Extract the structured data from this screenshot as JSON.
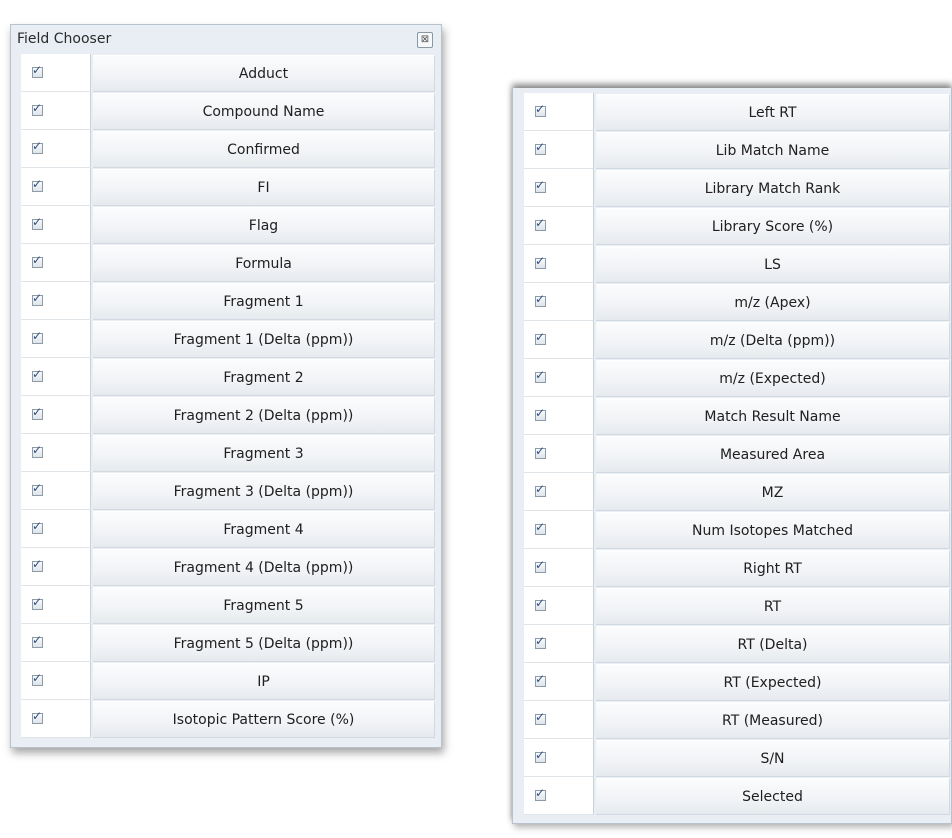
{
  "panel": {
    "title": "Field Chooser",
    "close_icon_glyph": "⊠"
  },
  "left_fields": [
    {
      "label": "Adduct",
      "checked": true
    },
    {
      "label": "Compound Name",
      "checked": true
    },
    {
      "label": "Confirmed",
      "checked": true
    },
    {
      "label": "FI",
      "checked": true
    },
    {
      "label": "Flag",
      "checked": true
    },
    {
      "label": "Formula",
      "checked": true
    },
    {
      "label": "Fragment 1",
      "checked": true
    },
    {
      "label": "Fragment 1 (Delta (ppm))",
      "checked": true
    },
    {
      "label": "Fragment 2",
      "checked": true
    },
    {
      "label": "Fragment 2 (Delta (ppm))",
      "checked": true
    },
    {
      "label": "Fragment 3",
      "checked": true
    },
    {
      "label": "Fragment 3 (Delta (ppm))",
      "checked": true
    },
    {
      "label": "Fragment 4",
      "checked": true
    },
    {
      "label": "Fragment 4 (Delta (ppm))",
      "checked": true
    },
    {
      "label": "Fragment 5",
      "checked": true
    },
    {
      "label": "Fragment 5 (Delta (ppm))",
      "checked": true
    },
    {
      "label": "IP",
      "checked": true
    },
    {
      "label": "Isotopic Pattern Score (%)",
      "checked": true
    }
  ],
  "right_fields": [
    {
      "label": "Left RT",
      "checked": true
    },
    {
      "label": "Lib Match Name",
      "checked": true
    },
    {
      "label": "Library Match Rank",
      "checked": true
    },
    {
      "label": "Library Score (%)",
      "checked": true
    },
    {
      "label": "LS",
      "checked": true
    },
    {
      "label": "m/z (Apex)",
      "checked": true
    },
    {
      "label": "m/z (Delta (ppm))",
      "checked": true
    },
    {
      "label": "m/z (Expected)",
      "checked": true
    },
    {
      "label": "Match Result Name",
      "checked": true
    },
    {
      "label": "Measured Area",
      "checked": true
    },
    {
      "label": "MZ",
      "checked": true
    },
    {
      "label": "Num Isotopes Matched",
      "checked": true
    },
    {
      "label": "Right RT",
      "checked": true
    },
    {
      "label": "RT",
      "checked": true
    },
    {
      "label": "RT (Delta)",
      "checked": true
    },
    {
      "label": "RT (Expected)",
      "checked": true
    },
    {
      "label": "RT (Measured)",
      "checked": true
    },
    {
      "label": "S/N",
      "checked": true
    },
    {
      "label": "Selected",
      "checked": true
    }
  ]
}
